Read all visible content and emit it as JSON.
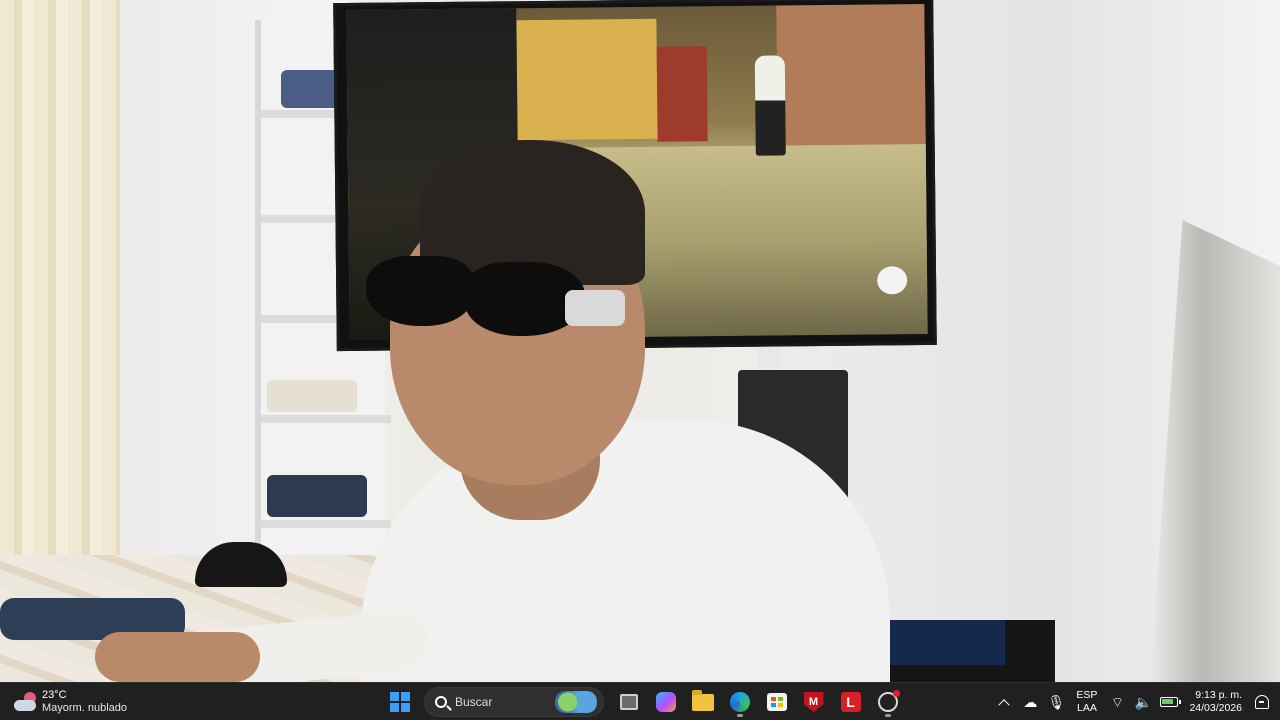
{
  "taskbar": {
    "weather": {
      "temperature": "23°C",
      "condition": "Mayorm. nublado",
      "icon": "partly-cloudy-icon"
    },
    "start": {
      "icon": "windows-logo-icon"
    },
    "search": {
      "placeholder": "Buscar",
      "icon": "search-icon"
    },
    "pinned_apps": [
      {
        "name": "task-view",
        "icon": "task-view-icon",
        "running": false
      },
      {
        "name": "copilot",
        "icon": "copilot-icon",
        "running": false
      },
      {
        "name": "file-explorer",
        "icon": "folder-icon",
        "running": false
      },
      {
        "name": "microsoft-edge",
        "icon": "edge-icon",
        "running": true
      },
      {
        "name": "microsoft-store",
        "icon": "store-icon",
        "running": false
      },
      {
        "name": "mcafee",
        "icon": "shield-icon",
        "running": false
      },
      {
        "name": "l-app",
        "icon": "l-app-icon",
        "label": "L",
        "running": false
      },
      {
        "name": "steam",
        "icon": "steam-icon",
        "running": true
      }
    ],
    "tray": {
      "show_hidden_icon": "chevron-up-icon",
      "cloud_status_icon": "cloud-offline-icon",
      "mic_icon": "microphone-icon",
      "language_top": "ESP",
      "language_bottom": "LAA",
      "wifi_icon": "wifi-icon",
      "volume_icon": "volume-icon",
      "battery_icon": "battery-charging-icon",
      "time": "9:13 p. m.",
      "date": "24/03/2026",
      "notification_icon": "bell-icon"
    },
    "colors": {
      "background": "#202020",
      "accent": "#4cc2ff",
      "windows_blue": "#3aa0f5"
    }
  }
}
